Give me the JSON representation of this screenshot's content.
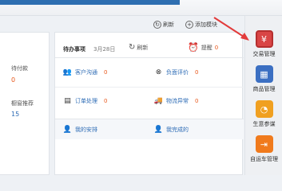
{
  "toolbar": {
    "refresh_label": "刷新",
    "add_label": "添加模块"
  },
  "left_panel": {
    "pending_pay_label": "待付款",
    "pending_pay_value": "0",
    "recommend_label": "橱窗推荐",
    "recommend_value": "15"
  },
  "tasks": {
    "title": "待办事项",
    "date": "3月28日",
    "refresh_label": "刷新",
    "remind_label": "提醒",
    "remind_count": "0",
    "items": [
      {
        "label": "客户沟通",
        "count": "0",
        "icon": "customers-icon"
      },
      {
        "label": "负面评价",
        "count": "0",
        "icon": "negative-review-icon"
      },
      {
        "label": "订单处理",
        "count": "0",
        "icon": "order-icon"
      },
      {
        "label": "物流异常",
        "count": "0",
        "icon": "logistics-icon"
      }
    ],
    "my_schedule": "我的安排",
    "my_completed": "我完成的"
  },
  "sidebar": {
    "items": [
      {
        "label": "交易管理",
        "color": "#d94545",
        "icon": "transaction-icon"
      },
      {
        "label": "商品管理",
        "color": "#3b6fc2",
        "icon": "goods-icon"
      },
      {
        "label": "生意参谋",
        "color": "#f0a020",
        "icon": "business-advisor-icon"
      },
      {
        "label": "自运车管理",
        "color": "#f07a1c",
        "icon": "store-management-icon"
      }
    ]
  }
}
